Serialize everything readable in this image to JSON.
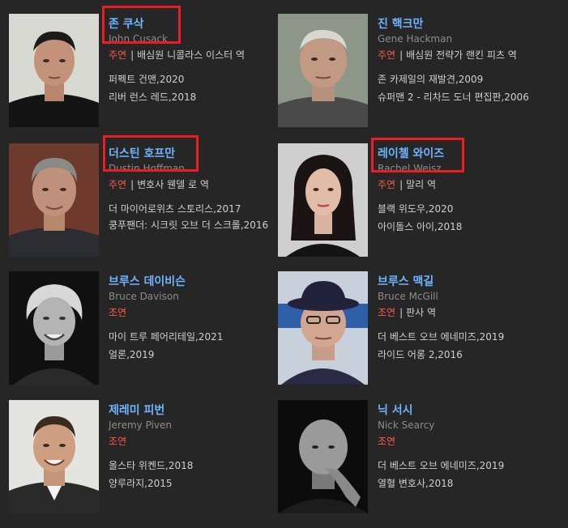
{
  "cast": [
    {
      "ko": "존 쿠삭",
      "en": "John Cusack",
      "type": "주연",
      "role": "배심원 니콜라스 이스터 역",
      "works": [
        "퍼펙트 건맨,2020",
        "리버 런스 레드,2018"
      ]
    },
    {
      "ko": "진 핵크만",
      "en": "Gene Hackman",
      "type": "주연",
      "role": "배심원 전략가 랜킨 피츠 역",
      "works": [
        "존 카제일의 재발견,2009",
        "슈퍼맨 2 - 리차드 도너 편집판,2006"
      ]
    },
    {
      "ko": "더스틴 호프만",
      "en": "Dustin Hoffman",
      "type": "주연",
      "role": "변호사 웬델 로 역",
      "works": [
        "더 마이어로위츠 스토리스,2017",
        "쿵푸팬더: 시크릿 오브 더 스크롤,2016"
      ]
    },
    {
      "ko": "레이첼 와이즈",
      "en": "Rachel Weisz",
      "type": "주연",
      "role": "말리 역",
      "works": [
        "블랙 위도우,2020",
        "아이돌스 아이,2018"
      ]
    },
    {
      "ko": "브루스 데이비슨",
      "en": "Bruce Davison",
      "type": "조연",
      "role": "",
      "works": [
        "마이 트루 페어리테일,2021",
        "얼론,2019"
      ]
    },
    {
      "ko": "브루스 맥길",
      "en": "Bruce McGill",
      "type": "조연",
      "role": "판사 역",
      "works": [
        "더 베스트 오브 에네미즈,2019",
        "라이드 어롱 2,2016"
      ]
    },
    {
      "ko": "제레미 피번",
      "en": "Jeremy Piven",
      "type": "조연",
      "role": "",
      "works": [
        "올스타 위켄드,2018",
        "양루라지,2015"
      ]
    },
    {
      "ko": "닉 서시",
      "en": "Nick Searcy",
      "type": "조연",
      "role": "",
      "works": [
        "더 베스트 오브 에네미즈,2019",
        "열혈 변호사,2018"
      ]
    }
  ],
  "colors": {
    "background": "#262626",
    "name_link": "#6fb3ff",
    "role_type": "#ff5a45",
    "highlight": "#ea1c24"
  }
}
